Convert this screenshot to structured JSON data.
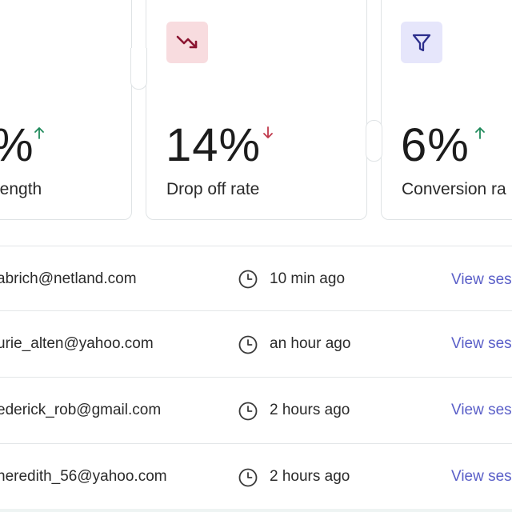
{
  "stats": [
    {
      "value": "%",
      "label": "length",
      "trend": "up",
      "trend_color": "#1f8a5b",
      "icon": "none-visible"
    },
    {
      "value": "14%",
      "label": "Drop off rate",
      "trend": "down",
      "trend_color": "#c0394b",
      "icon": "trending-down-icon",
      "icon_bg": "#f8dcdf",
      "icon_color": "#8b1430"
    },
    {
      "value": "6%",
      "label": "Conversion ra",
      "trend": "up",
      "trend_color": "#1f8a5b",
      "icon": "funnel-icon",
      "icon_bg": "#e6e6fb",
      "icon_color": "#2c2e8c"
    }
  ],
  "sessions": {
    "rows": [
      {
        "email": "abrich@netland.com",
        "time": "10 min ago",
        "link": "View ses"
      },
      {
        "email": "urie_alten@yahoo.com",
        "time": "an hour ago",
        "link": "View ses"
      },
      {
        "email": "ederick_rob@gmail.com",
        "time": "2 hours ago",
        "link": "View ses"
      },
      {
        "email": "neredith_56@yahoo.com",
        "time": "2 hours ago",
        "link": "View ses"
      }
    ],
    "link_color": "#5a5fc8"
  }
}
